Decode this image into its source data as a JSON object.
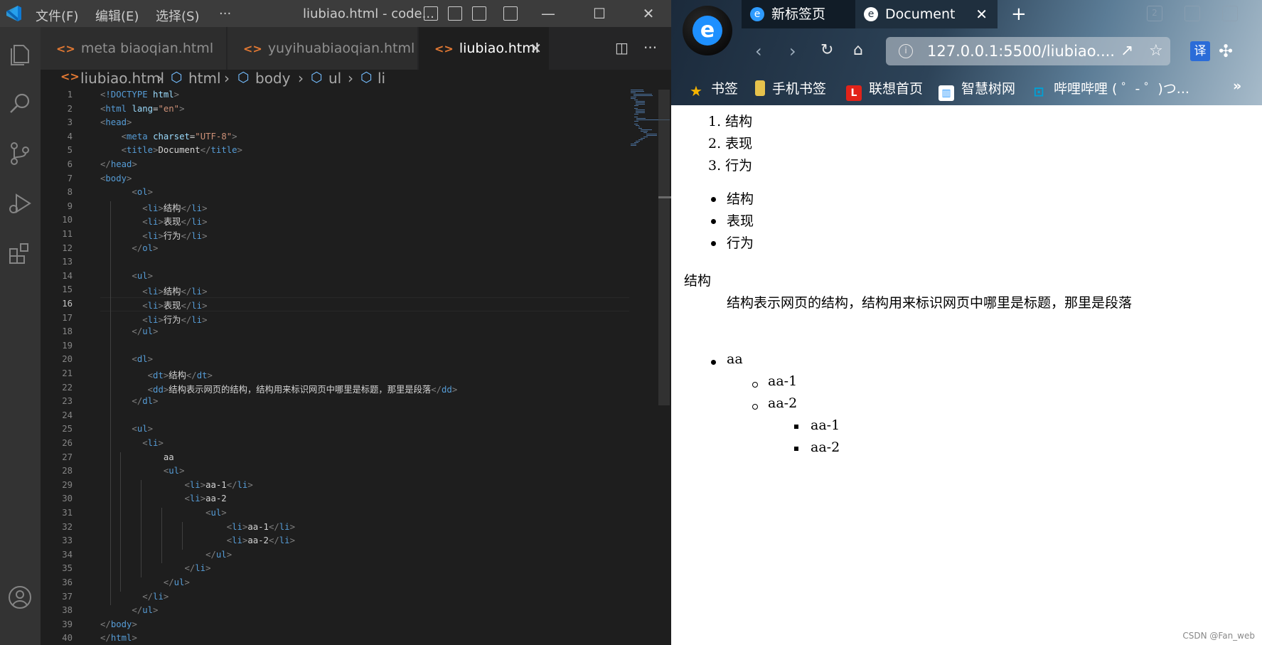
{
  "vscode": {
    "menu": [
      "文件(F)",
      "编辑(E)",
      "选择(S)",
      "···"
    ],
    "window_title": "liubiao.html - code...",
    "tabs": [
      {
        "label": "meta  biaoqian.html"
      },
      {
        "label": "yuyihuabiaoqian.html"
      },
      {
        "label": "liubiao.html",
        "active": true
      }
    ],
    "breadcrumb": [
      "liubiao.html",
      "html",
      "body",
      "ul",
      "li"
    ],
    "current_line": 16,
    "lines": [
      "<!DOCTYPE html>",
      "<html lang=\"en\">",
      "<head>",
      "    <meta charset=\"UTF-8\">",
      "    <title>Document</title>",
      "</head>",
      "<body>",
      "      <ol>",
      "        <li>结构</li>",
      "        <li>表现</li>",
      "        <li>行为</li>",
      "      </ol>",
      "",
      "      <ul>",
      "        <li>结构</li>",
      "        <li>表现</li>",
      "        <li>行为</li>",
      "      </ul>",
      "",
      "      <dl>",
      "         <dt>结构</dt>",
      "         <dd>结构表示网页的结构，结构用来标识网页中哪里是标题，那里是段落</dd>",
      "      </dl>",
      "",
      "      <ul>",
      "        <li>",
      "            aa",
      "            <ul>",
      "                <li>aa-1</li>",
      "                <li>aa-2",
      "                    <ul>",
      "                        <li>aa-1</li>",
      "                        <li>aa-2</li>",
      "                    </ul>",
      "                </li>",
      "            </ul>",
      "        </li>",
      "      </ul>",
      "</body>",
      "</html>"
    ]
  },
  "browser": {
    "tabs": [
      {
        "label": "新标签页"
      },
      {
        "label": "Document",
        "active": true
      }
    ],
    "address": "127.0.0.1:5500/liubiao....",
    "bookmarks": [
      "书签",
      "手机书签",
      "联想首页",
      "智慧树网",
      "哔哩哔哩 ( ゜- ゜)つ..."
    ],
    "translate_label": "译",
    "tab_count": "2",
    "page": {
      "ol": [
        "1. 结构",
        "2. 表现",
        "3. 行为"
      ],
      "ul": [
        "结构",
        "表现",
        "行为"
      ],
      "dt": "结构",
      "dd": "结构表示网页的结构，结构用来标识网页中哪里是标题，那里是段落",
      "nested": {
        "item": "aa",
        "sub": [
          "aa-1",
          "aa-2"
        ],
        "subsub": [
          "aa-1",
          "aa-2"
        ]
      }
    },
    "watermark": "CSDN @Fan_web"
  },
  "colors": {
    "vscode_bg": "#1e1e1e",
    "tag": "#569cd6",
    "attr": "#9cdcfe",
    "string": "#ce9178",
    "html_file_icon": "#e37933"
  }
}
